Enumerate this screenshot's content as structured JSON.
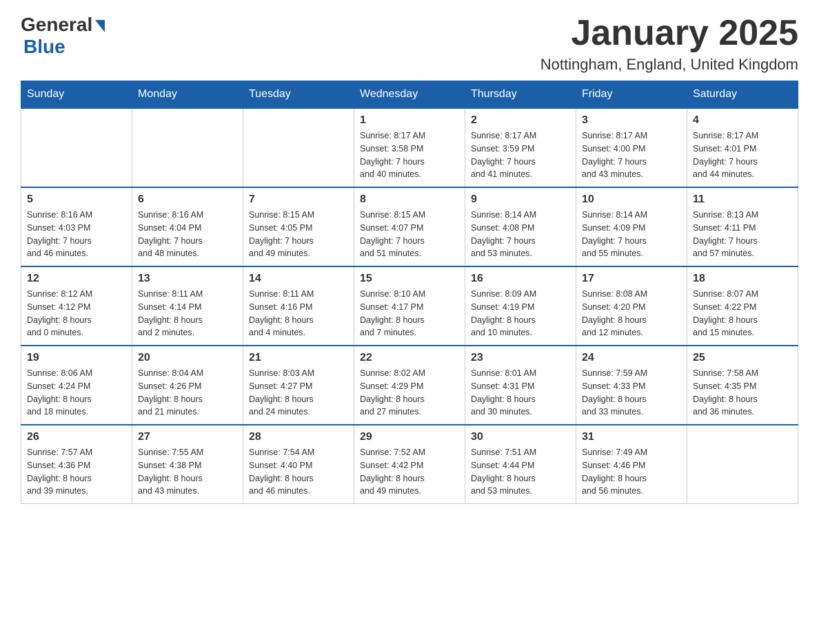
{
  "logo": {
    "general": "General",
    "blue": "Blue"
  },
  "header": {
    "month": "January 2025",
    "location": "Nottingham, England, United Kingdom"
  },
  "days_of_week": [
    "Sunday",
    "Monday",
    "Tuesday",
    "Wednesday",
    "Thursday",
    "Friday",
    "Saturday"
  ],
  "weeks": [
    [
      {
        "day": "",
        "info": ""
      },
      {
        "day": "",
        "info": ""
      },
      {
        "day": "",
        "info": ""
      },
      {
        "day": "1",
        "info": "Sunrise: 8:17 AM\nSunset: 3:58 PM\nDaylight: 7 hours\nand 40 minutes."
      },
      {
        "day": "2",
        "info": "Sunrise: 8:17 AM\nSunset: 3:59 PM\nDaylight: 7 hours\nand 41 minutes."
      },
      {
        "day": "3",
        "info": "Sunrise: 8:17 AM\nSunset: 4:00 PM\nDaylight: 7 hours\nand 43 minutes."
      },
      {
        "day": "4",
        "info": "Sunrise: 8:17 AM\nSunset: 4:01 PM\nDaylight: 7 hours\nand 44 minutes."
      }
    ],
    [
      {
        "day": "5",
        "info": "Sunrise: 8:16 AM\nSunset: 4:03 PM\nDaylight: 7 hours\nand 46 minutes."
      },
      {
        "day": "6",
        "info": "Sunrise: 8:16 AM\nSunset: 4:04 PM\nDaylight: 7 hours\nand 48 minutes."
      },
      {
        "day": "7",
        "info": "Sunrise: 8:15 AM\nSunset: 4:05 PM\nDaylight: 7 hours\nand 49 minutes."
      },
      {
        "day": "8",
        "info": "Sunrise: 8:15 AM\nSunset: 4:07 PM\nDaylight: 7 hours\nand 51 minutes."
      },
      {
        "day": "9",
        "info": "Sunrise: 8:14 AM\nSunset: 4:08 PM\nDaylight: 7 hours\nand 53 minutes."
      },
      {
        "day": "10",
        "info": "Sunrise: 8:14 AM\nSunset: 4:09 PM\nDaylight: 7 hours\nand 55 minutes."
      },
      {
        "day": "11",
        "info": "Sunrise: 8:13 AM\nSunset: 4:11 PM\nDaylight: 7 hours\nand 57 minutes."
      }
    ],
    [
      {
        "day": "12",
        "info": "Sunrise: 8:12 AM\nSunset: 4:12 PM\nDaylight: 8 hours\nand 0 minutes."
      },
      {
        "day": "13",
        "info": "Sunrise: 8:11 AM\nSunset: 4:14 PM\nDaylight: 8 hours\nand 2 minutes."
      },
      {
        "day": "14",
        "info": "Sunrise: 8:11 AM\nSunset: 4:16 PM\nDaylight: 8 hours\nand 4 minutes."
      },
      {
        "day": "15",
        "info": "Sunrise: 8:10 AM\nSunset: 4:17 PM\nDaylight: 8 hours\nand 7 minutes."
      },
      {
        "day": "16",
        "info": "Sunrise: 8:09 AM\nSunset: 4:19 PM\nDaylight: 8 hours\nand 10 minutes."
      },
      {
        "day": "17",
        "info": "Sunrise: 8:08 AM\nSunset: 4:20 PM\nDaylight: 8 hours\nand 12 minutes."
      },
      {
        "day": "18",
        "info": "Sunrise: 8:07 AM\nSunset: 4:22 PM\nDaylight: 8 hours\nand 15 minutes."
      }
    ],
    [
      {
        "day": "19",
        "info": "Sunrise: 8:06 AM\nSunset: 4:24 PM\nDaylight: 8 hours\nand 18 minutes."
      },
      {
        "day": "20",
        "info": "Sunrise: 8:04 AM\nSunset: 4:26 PM\nDaylight: 8 hours\nand 21 minutes."
      },
      {
        "day": "21",
        "info": "Sunrise: 8:03 AM\nSunset: 4:27 PM\nDaylight: 8 hours\nand 24 minutes."
      },
      {
        "day": "22",
        "info": "Sunrise: 8:02 AM\nSunset: 4:29 PM\nDaylight: 8 hours\nand 27 minutes."
      },
      {
        "day": "23",
        "info": "Sunrise: 8:01 AM\nSunset: 4:31 PM\nDaylight: 8 hours\nand 30 minutes."
      },
      {
        "day": "24",
        "info": "Sunrise: 7:59 AM\nSunset: 4:33 PM\nDaylight: 8 hours\nand 33 minutes."
      },
      {
        "day": "25",
        "info": "Sunrise: 7:58 AM\nSunset: 4:35 PM\nDaylight: 8 hours\nand 36 minutes."
      }
    ],
    [
      {
        "day": "26",
        "info": "Sunrise: 7:57 AM\nSunset: 4:36 PM\nDaylight: 8 hours\nand 39 minutes."
      },
      {
        "day": "27",
        "info": "Sunrise: 7:55 AM\nSunset: 4:38 PM\nDaylight: 8 hours\nand 43 minutes."
      },
      {
        "day": "28",
        "info": "Sunrise: 7:54 AM\nSunset: 4:40 PM\nDaylight: 8 hours\nand 46 minutes."
      },
      {
        "day": "29",
        "info": "Sunrise: 7:52 AM\nSunset: 4:42 PM\nDaylight: 8 hours\nand 49 minutes."
      },
      {
        "day": "30",
        "info": "Sunrise: 7:51 AM\nSunset: 4:44 PM\nDaylight: 8 hours\nand 53 minutes."
      },
      {
        "day": "31",
        "info": "Sunrise: 7:49 AM\nSunset: 4:46 PM\nDaylight: 8 hours\nand 56 minutes."
      },
      {
        "day": "",
        "info": ""
      }
    ]
  ]
}
